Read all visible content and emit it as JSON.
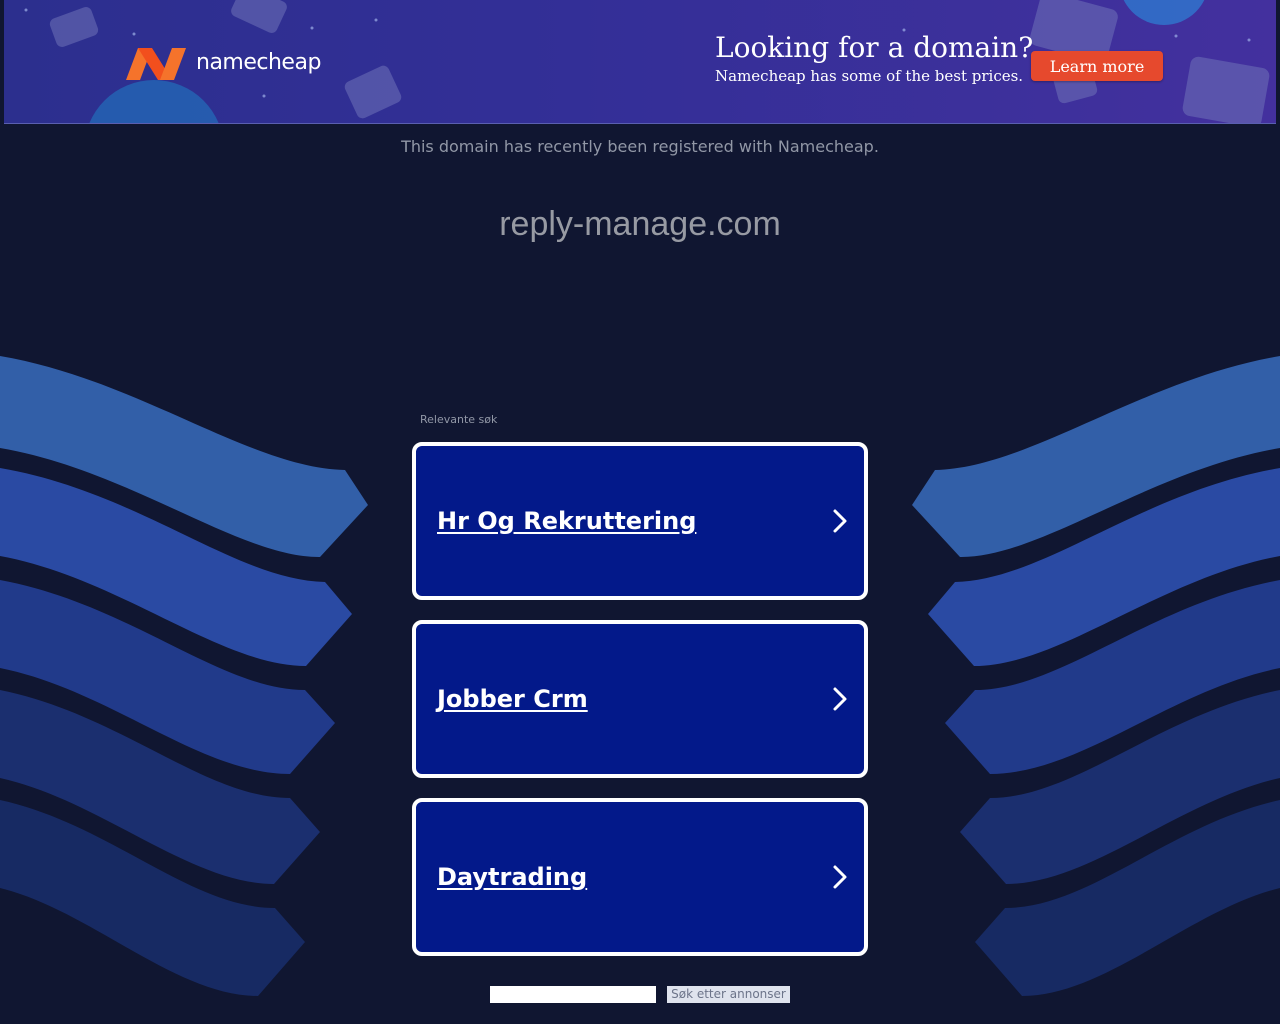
{
  "banner": {
    "brand_name": "namecheap",
    "logo_icon": "namecheap-n-logo",
    "headline": "Looking for a domain?",
    "subline": "Namecheap has some of the best prices.",
    "cta_label": "Learn more",
    "colors": {
      "background": "#332f97",
      "cta": "#e6492d",
      "logo_orange": "#f5732b"
    }
  },
  "main": {
    "registered_note": "This domain has recently been registered with Namecheap.",
    "domain": "reply-manage.com",
    "related_label": "Relevante søk",
    "ads": [
      {
        "label": "Hr Og Rekruttering",
        "icon": "chevron-right-icon"
      },
      {
        "label": "Jobber Crm",
        "icon": "chevron-right-icon"
      },
      {
        "label": "Daytrading",
        "icon": "chevron-right-icon"
      }
    ],
    "search": {
      "input_value": "",
      "button_label": "Søk etter annonser"
    },
    "colors": {
      "page_background": "#101631",
      "card_background": "#03198a",
      "card_border": "#ffffff"
    }
  }
}
